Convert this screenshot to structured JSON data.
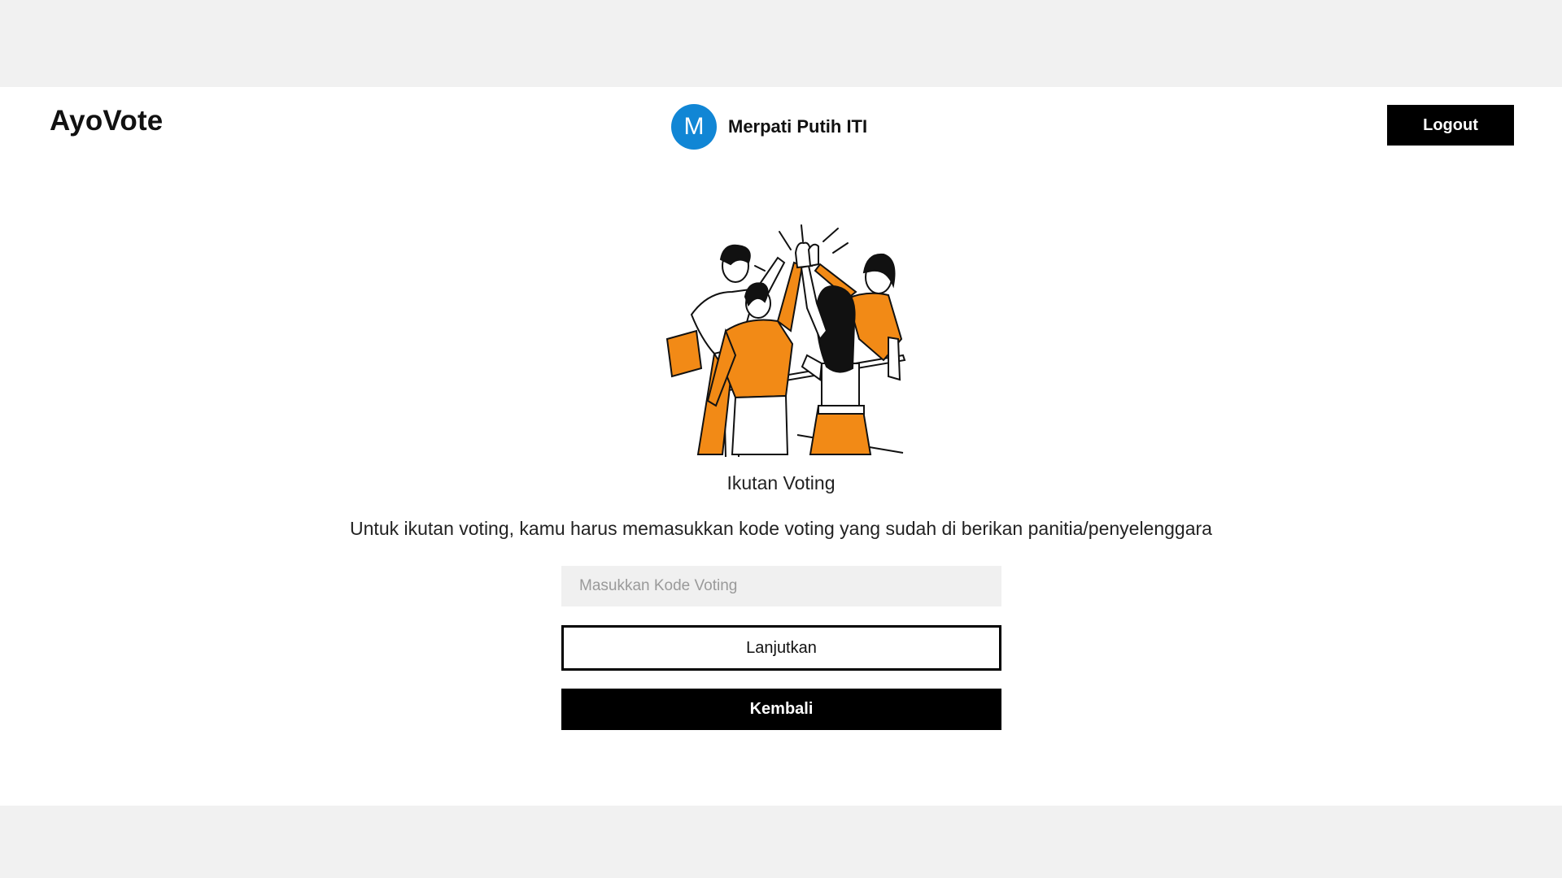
{
  "app": {
    "brand": "AyoVote"
  },
  "user": {
    "avatar_letter": "M",
    "name": "Merpati Putih ITI"
  },
  "header": {
    "logout_label": "Logout"
  },
  "main": {
    "illustration": "team-high-five-illustration",
    "heading": "Ikutan Voting",
    "description": "Untuk ikutan voting, kamu harus memasukkan kode voting yang sudah di berikan panitia/penyelenggara",
    "code_input": {
      "placeholder": "Masukkan Kode Voting",
      "value": ""
    },
    "next_label": "Lanjutkan",
    "back_label": "Kembali"
  },
  "colors": {
    "avatar": "#1186d5",
    "illustration_accent": "#f28a16",
    "primary_button": "#000000",
    "background": "#f1f1f1"
  }
}
